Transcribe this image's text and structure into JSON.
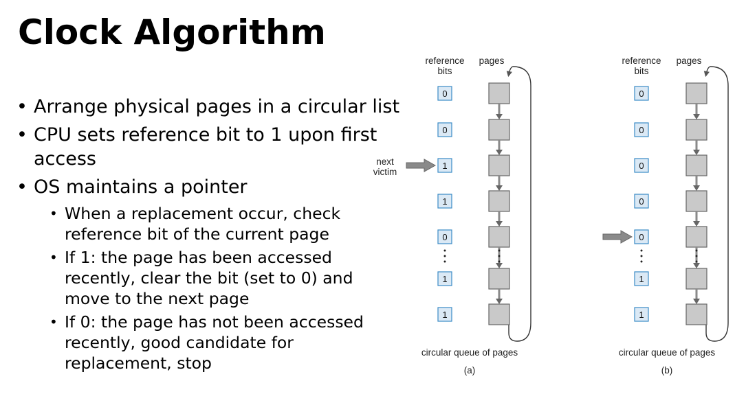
{
  "slide": {
    "title": "Clock Algorithm",
    "bullets": [
      {
        "text": "Arrange physical pages in a circular list",
        "level": 1
      },
      {
        "text": "CPU sets reference bit to 1 upon first access",
        "level": 1
      },
      {
        "text": "OS maintains a pointer",
        "level": 1
      },
      {
        "text": "When a replacement occur, check reference bit of the current page",
        "level": 2
      },
      {
        "text": "If 1: the page has been accessed recently, clear the bit (set to 0) and move to the next page",
        "level": 2
      },
      {
        "text": "If 0: the page has not been accessed recently, good candidate for replacement, stop",
        "level": 2
      }
    ]
  },
  "diagrams": [
    {
      "caption": "(a)",
      "label_bits": "reference bits",
      "label_pages": "pages",
      "label_queue": "circular queue of pages",
      "pointer_label": "next victim",
      "bits": [
        "0",
        "0",
        "1",
        "1",
        "0",
        "1",
        "1"
      ],
      "pointer_index": 2
    },
    {
      "caption": "(b)",
      "label_bits": "reference bits",
      "label_pages": "pages",
      "label_queue": "circular queue of pages",
      "pointer_label": "",
      "bits": [
        "0",
        "0",
        "0",
        "0",
        "0",
        "1",
        "1"
      ],
      "pointer_index": 4
    }
  ],
  "colors": {
    "bit_fill": "#dbe9f5",
    "bit_stroke": "#3a8bc6",
    "page_fill": "#c9c9c9",
    "page_stroke": "#666666",
    "arrow_fill": "#8a8a8a"
  }
}
